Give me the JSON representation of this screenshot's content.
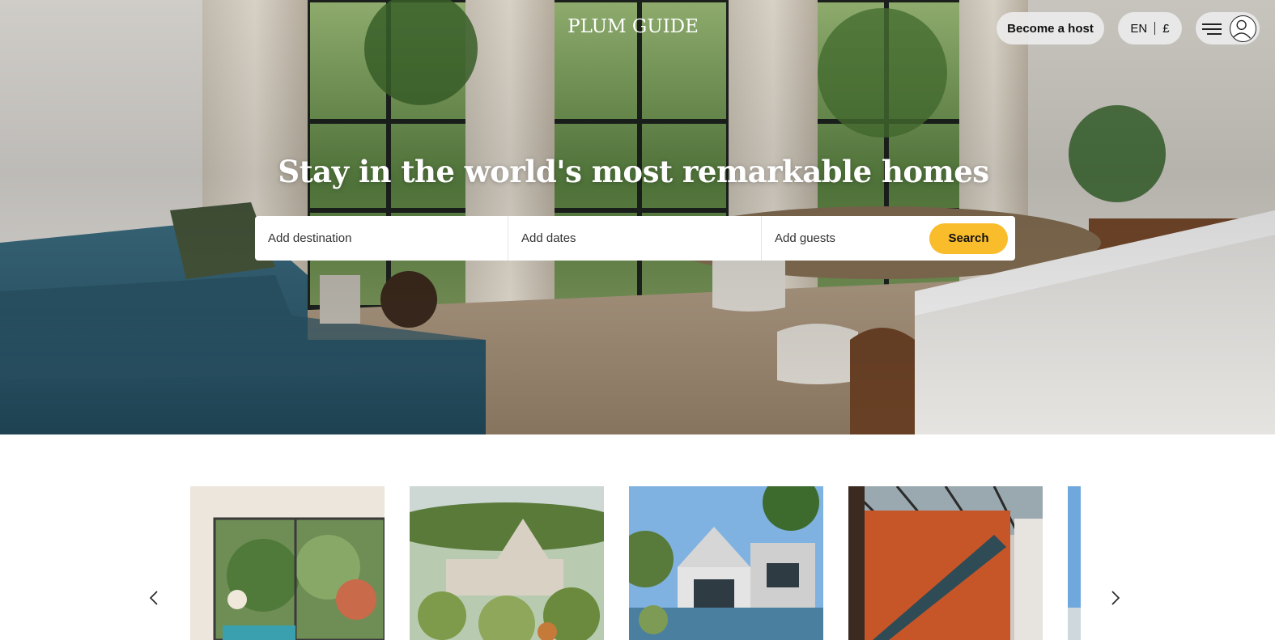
{
  "header": {
    "logo": "PLUM GUIDE",
    "become_host": "Become a host",
    "language": "EN",
    "currency": "£",
    "menu_icon": "hamburger-menu-icon",
    "account_icon": "user-avatar-icon"
  },
  "hero": {
    "headline": "Stay in the world's most remarkable homes",
    "search": {
      "destination_placeholder": "Add destination",
      "dates_placeholder": "Add dates",
      "guests_placeholder": "Add guests",
      "button_label": "Search"
    }
  },
  "carousel": {
    "prev_icon": "chevron-left-icon",
    "next_icon": "chevron-right-icon",
    "cards": [
      {
        "image": "modern-interior-garden"
      },
      {
        "image": "trullo-stone-house"
      },
      {
        "image": "modern-barn-house-pool"
      },
      {
        "image": "orange-wall-staircase"
      },
      {
        "image": "sky-partial"
      }
    ]
  },
  "colors": {
    "accent": "#f9bd2c",
    "sofa": "#2f5d70"
  }
}
